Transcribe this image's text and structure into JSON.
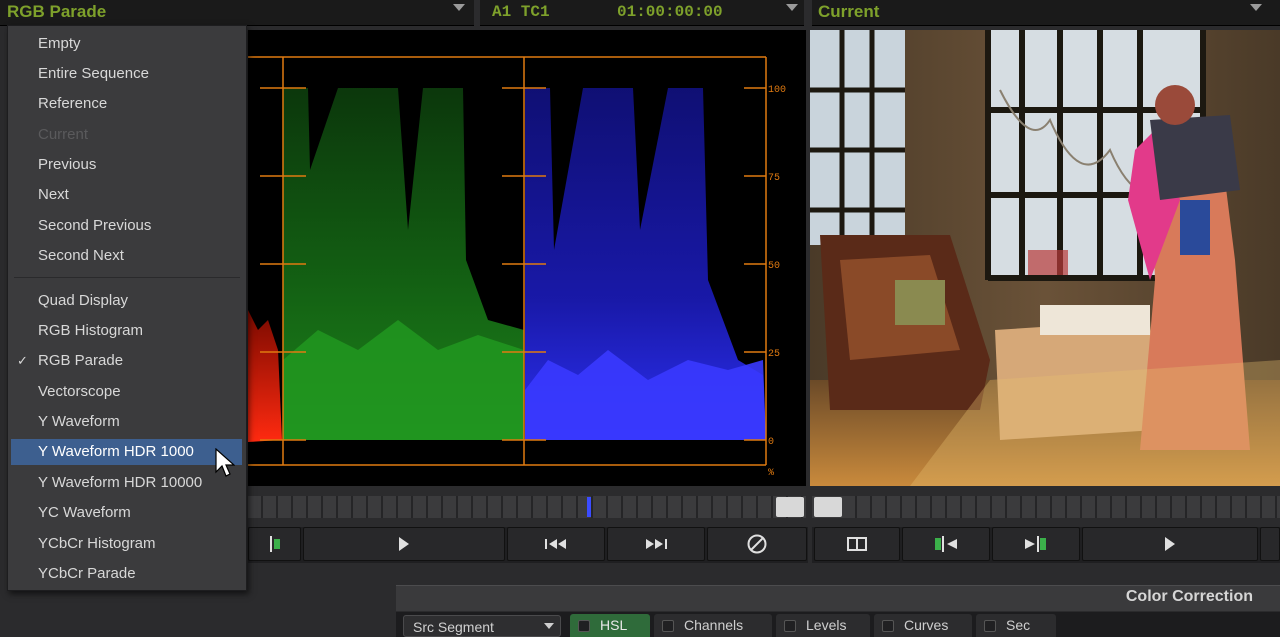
{
  "header": {
    "scope_selector_label": "RGB Parade",
    "timecode_track": "A1 TC1",
    "timecode_value": "01:00:00:00",
    "viewer_source_label": "Current"
  },
  "scope_menu": {
    "items": [
      {
        "label": "Empty",
        "state": "normal"
      },
      {
        "label": "Entire Sequence",
        "state": "normal"
      },
      {
        "label": "Reference",
        "state": "normal"
      },
      {
        "label": "Current",
        "state": "disabled"
      },
      {
        "label": "Previous",
        "state": "normal"
      },
      {
        "label": "Next",
        "state": "normal"
      },
      {
        "label": "Second Previous",
        "state": "normal"
      },
      {
        "label": "Second Next",
        "state": "normal"
      },
      {
        "label": "Quad Display",
        "state": "normal"
      },
      {
        "label": "RGB Histogram",
        "state": "normal"
      },
      {
        "label": "RGB Parade",
        "state": "checked"
      },
      {
        "label": "Vectorscope",
        "state": "normal"
      },
      {
        "label": "Y Waveform",
        "state": "normal"
      },
      {
        "label": "Y Waveform HDR 1000",
        "state": "highlighted"
      },
      {
        "label": "Y Waveform HDR 10000",
        "state": "normal"
      },
      {
        "label": "YC Waveform",
        "state": "normal"
      },
      {
        "label": "YCbCr Histogram",
        "state": "normal"
      },
      {
        "label": "YCbCr Parade",
        "state": "normal"
      }
    ],
    "check_glyph": "✓"
  },
  "scope": {
    "scale_labels": [
      "100",
      "75",
      "50",
      "25",
      "0",
      "%"
    ],
    "colors": {
      "red": "#ff2a10",
      "green": "#1f8a1c",
      "blue": "#2a2cff",
      "graticule": "#e07a10"
    }
  },
  "transport": {
    "left_icons": [
      "mark-in-icon",
      "play-icon",
      "step-back-icon",
      "step-forward-icon",
      "no-entry-icon"
    ],
    "right_icons": [
      "split-view-icon",
      "go-to-in-icon",
      "go-to-out-icon",
      "play-icon"
    ]
  },
  "color_correction": {
    "title": "Color Correction",
    "mode_select": "Src Segment",
    "tabs": [
      {
        "label": "HSL",
        "active": true
      },
      {
        "label": "Channels",
        "active": false
      },
      {
        "label": "Levels",
        "active": false
      },
      {
        "label": "Curves",
        "active": false
      },
      {
        "label": "Sec",
        "active": false
      }
    ]
  }
}
